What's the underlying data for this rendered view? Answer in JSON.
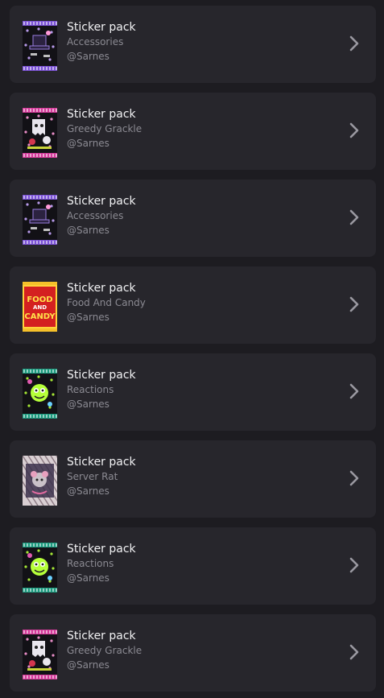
{
  "items": [
    {
      "title": "Sticker pack",
      "name": "Accessories",
      "author": "@Sarnes",
      "art": "accessories-pack-icon",
      "color": "#7b52d6",
      "accent": "#c9a8ff"
    },
    {
      "title": "Sticker pack",
      "name": "Greedy Grackle",
      "author": "@Sarnes",
      "art": "greedy-grackle-pack-icon",
      "color": "#d43a9a",
      "accent": "#ff9ad9"
    },
    {
      "title": "Sticker pack",
      "name": "Accessories",
      "author": "@Sarnes",
      "art": "accessories-pack-icon",
      "color": "#7b52d6",
      "accent": "#c9a8ff"
    },
    {
      "title": "Sticker pack",
      "name": "Food And Candy",
      "author": "@Sarnes",
      "art": "food-and-candy-pack-icon",
      "color": "#d42020",
      "accent": "#ffd23a",
      "pack_text": [
        "FOOD",
        "AND",
        "CANDY"
      ]
    },
    {
      "title": "Sticker pack",
      "name": "Reactions",
      "author": "@Sarnes",
      "art": "reactions-pack-icon",
      "color": "#1c9a7e",
      "accent": "#b6ff3a"
    },
    {
      "title": "Sticker pack",
      "name": "Server Rat",
      "author": "@Sarnes",
      "art": "server-rat-pack-icon",
      "color": "#b9a6ad",
      "accent": "#e06aa0"
    },
    {
      "title": "Sticker pack",
      "name": "Reactions",
      "author": "@Sarnes",
      "art": "reactions-pack-icon",
      "color": "#1c9a7e",
      "accent": "#b6ff3a"
    },
    {
      "title": "Sticker pack",
      "name": "Greedy Grackle",
      "author": "@Sarnes",
      "art": "greedy-grackle-pack-icon",
      "color": "#d43a9a",
      "accent": "#ff9ad9"
    }
  ],
  "chevron_icon": "chevron-right-icon"
}
